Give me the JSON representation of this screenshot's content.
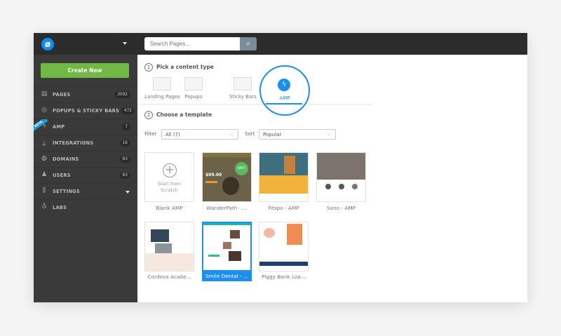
{
  "topbar": {
    "search_placeholder": "Search Pages...",
    "logo": "ø"
  },
  "sidebar": {
    "create_label": "Create New",
    "beta_label": "BETA",
    "items": [
      {
        "label": "PAGES",
        "count": "3092",
        "icon": "pages-icon",
        "glyph": "▤"
      },
      {
        "label": "POPUPS & STICKY BARS",
        "count": "472",
        "icon": "target-icon",
        "glyph": "◎"
      },
      {
        "label": "AMP",
        "count": "7",
        "icon": "bolt-icon",
        "glyph": "ϟ"
      },
      {
        "label": "INTEGRATIONS",
        "count": "16",
        "icon": "plug-icon",
        "glyph": "⏚"
      },
      {
        "label": "DOMAINS",
        "count": "83",
        "icon": "globe-icon",
        "glyph": "◍"
      },
      {
        "label": "USERS",
        "count": "83",
        "icon": "users-icon",
        "glyph": "♟"
      },
      {
        "label": "SETTINGS",
        "count": "",
        "icon": "sliders-icon",
        "glyph": "⫼"
      },
      {
        "label": "LABS",
        "count": "",
        "icon": "flask-icon",
        "glyph": "♁"
      }
    ]
  },
  "main": {
    "step1": {
      "num": "1",
      "label": "Pick a content type"
    },
    "content_types": [
      "Landing Pages",
      "Popups",
      "Sticky Bars",
      "AMP"
    ],
    "step2": {
      "num": "2",
      "label": "Choose a template"
    },
    "filter": {
      "label": "Filter",
      "value": "All (7)"
    },
    "sort": {
      "label": "Sort",
      "value": "Popular"
    },
    "blank": {
      "line1": "Start from",
      "line2": "Scratch"
    },
    "templates": [
      "Blank AMP",
      "WanderPath - ...",
      "Fitspo - AMP",
      "Sano - AMP",
      "Cordova Acade...",
      "Smile Dental - ...",
      "Piggy Bank Loa..."
    ],
    "wander": {
      "price": "$99.00",
      "badge": "$60!"
    },
    "accent": "#1a8ff0"
  }
}
